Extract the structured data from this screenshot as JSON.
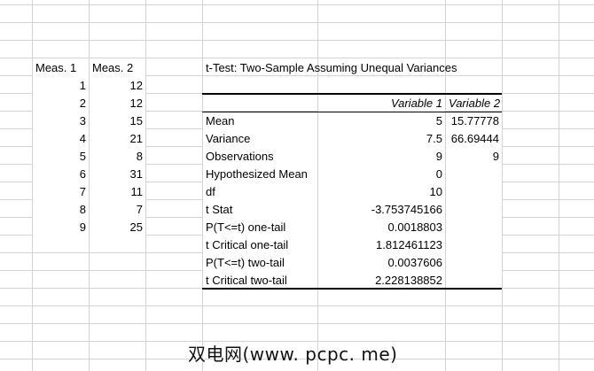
{
  "data_table": {
    "headers": [
      "Meas. 1",
      "Meas. 2"
    ],
    "rows": [
      [
        1,
        12
      ],
      [
        2,
        12
      ],
      [
        3,
        15
      ],
      [
        4,
        21
      ],
      [
        5,
        8
      ],
      [
        6,
        31
      ],
      [
        7,
        11
      ],
      [
        8,
        7
      ],
      [
        9,
        25
      ]
    ]
  },
  "ttest": {
    "title": "t-Test: Two-Sample Assuming Unequal Variances",
    "columns": [
      "Variable 1",
      "Variable 2"
    ],
    "rows": [
      {
        "label": "Mean",
        "v1": "5",
        "v2": "15.77778"
      },
      {
        "label": "Variance",
        "v1": "7.5",
        "v2": "66.69444"
      },
      {
        "label": "Observations",
        "v1": "9",
        "v2": "9"
      },
      {
        "label": "Hypothesized Mean",
        "v1": "0",
        "v2": ""
      },
      {
        "label": "df",
        "v1": "10",
        "v2": ""
      },
      {
        "label": "t Stat",
        "v1": "-3.753745166",
        "v2": ""
      },
      {
        "label": "P(T<=t) one-tail",
        "v1": "0.0018803",
        "v2": ""
      },
      {
        "label": "t Critical one-tail",
        "v1": "1.812461123",
        "v2": ""
      },
      {
        "label": "P(T<=t) two-tail",
        "v1": "0.0037606",
        "v2": ""
      },
      {
        "label": "t Critical two-tail",
        "v1": "2.228138852",
        "v2": ""
      }
    ]
  },
  "watermark": "双电网(www. pcpc. me)"
}
